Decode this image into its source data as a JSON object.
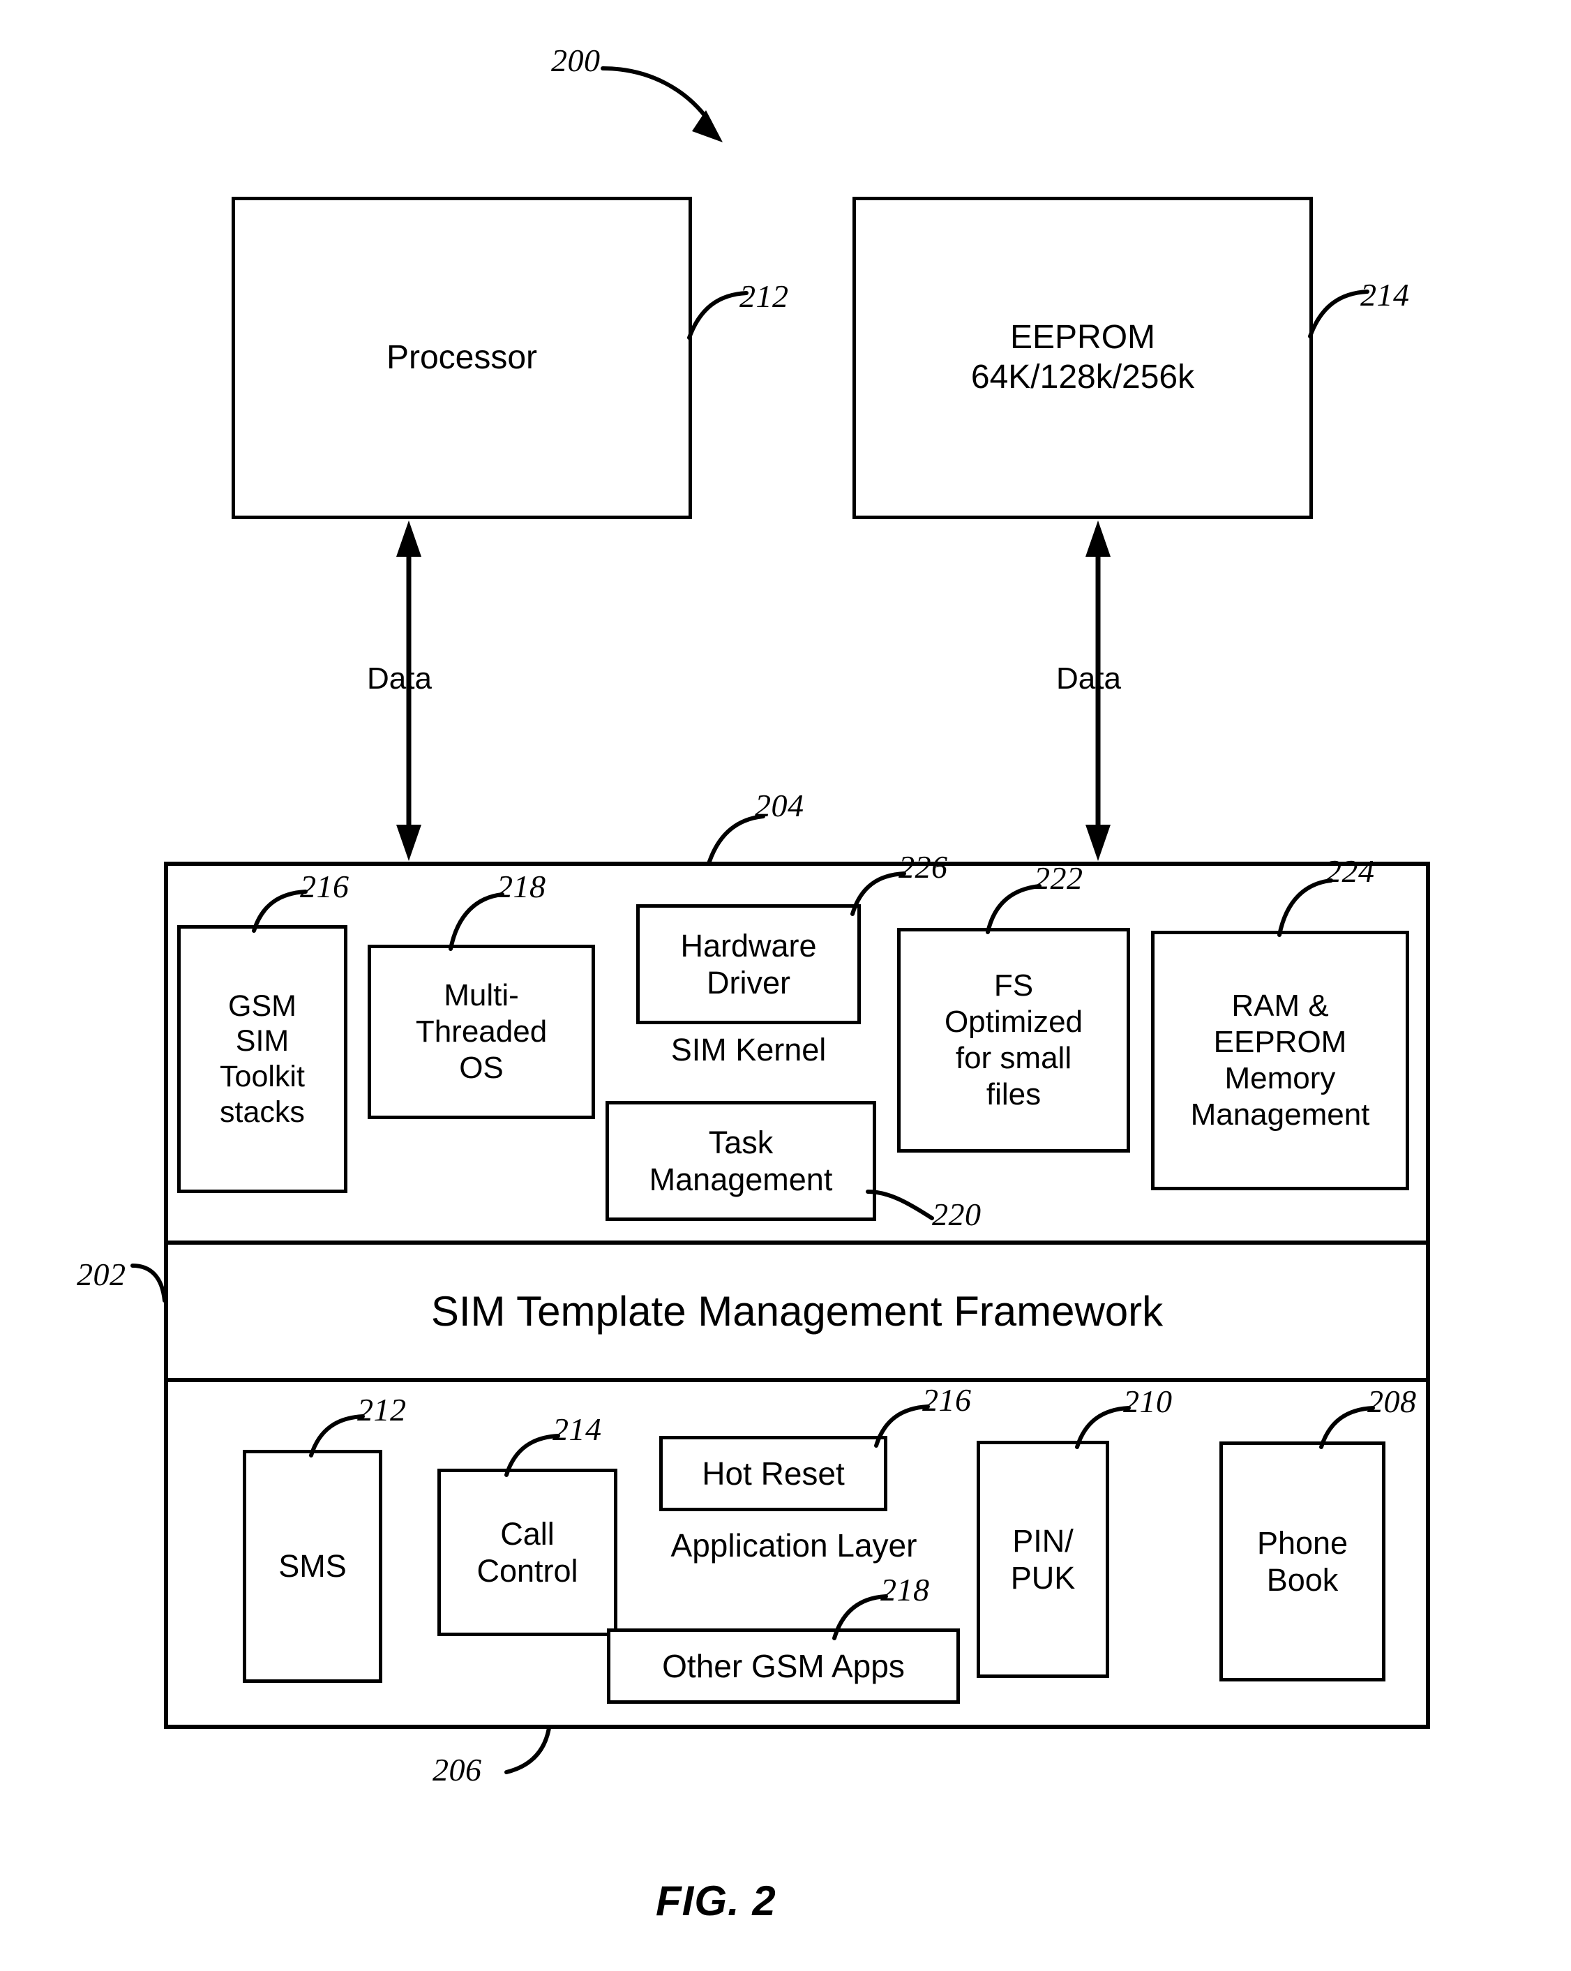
{
  "figure": {
    "caption": "FIG. 2",
    "system_ref": "200"
  },
  "top_blocks": [
    {
      "label": "Processor",
      "ref": "212"
    },
    {
      "label": "EEPROM\n64K/128k/256k",
      "ref": "214"
    }
  ],
  "connectors": [
    {
      "label": "Data"
    },
    {
      "label": "Data"
    }
  ],
  "sim_container": {
    "ref_left": "202",
    "ref_kernel_layer": "204",
    "ref_application_layer": "206"
  },
  "kernel_layer": {
    "group_label": "SIM Kernel",
    "blocks": [
      {
        "label": "GSM\nSIM\nToolkit\nstacks",
        "ref": "216"
      },
      {
        "label": "Multi-\nThreaded\nOS",
        "ref": "218"
      },
      {
        "label": "Hardware\nDriver",
        "ref": "226"
      },
      {
        "label": "Task\nManagement",
        "ref": "220"
      },
      {
        "label": "FS\nOptimized\nfor small\nfiles",
        "ref": "222"
      },
      {
        "label": "RAM &\nEEPROM\nMemory\nManagement",
        "ref": "224"
      }
    ]
  },
  "framework_layer": {
    "label": "SIM Template Management Framework"
  },
  "application_layer": {
    "group_label": "Application Layer",
    "blocks": [
      {
        "label": "SMS",
        "ref": "212"
      },
      {
        "label": "Call\nControl",
        "ref": "214"
      },
      {
        "label": "Hot Reset",
        "ref": "216"
      },
      {
        "label": "Other GSM Apps",
        "ref": "218"
      },
      {
        "label": "PIN/\nPUK",
        "ref": "210"
      },
      {
        "label": "Phone\nBook",
        "ref": "208"
      }
    ]
  },
  "colors": {
    "ink": "#000000",
    "paper": "#ffffff"
  }
}
